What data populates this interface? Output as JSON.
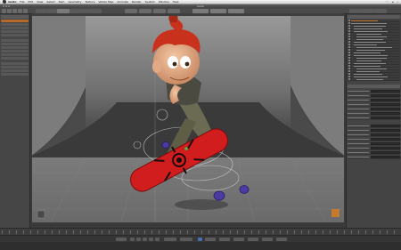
{
  "menubar": {
    "app_name": "modo",
    "items": [
      "File",
      "Edit",
      "View",
      "Select",
      "Item",
      "Geometry",
      "Texture",
      "Vertex Map",
      "Animate",
      "Render",
      "System",
      "Window",
      "Help"
    ]
  },
  "window": {
    "title": "modo"
  },
  "colors": {
    "accent_orange": "#c67a2e",
    "skateboard_red": "#d11d1d",
    "wheel_purple": "#4b3aa0",
    "hair_red": "#c8321c"
  }
}
